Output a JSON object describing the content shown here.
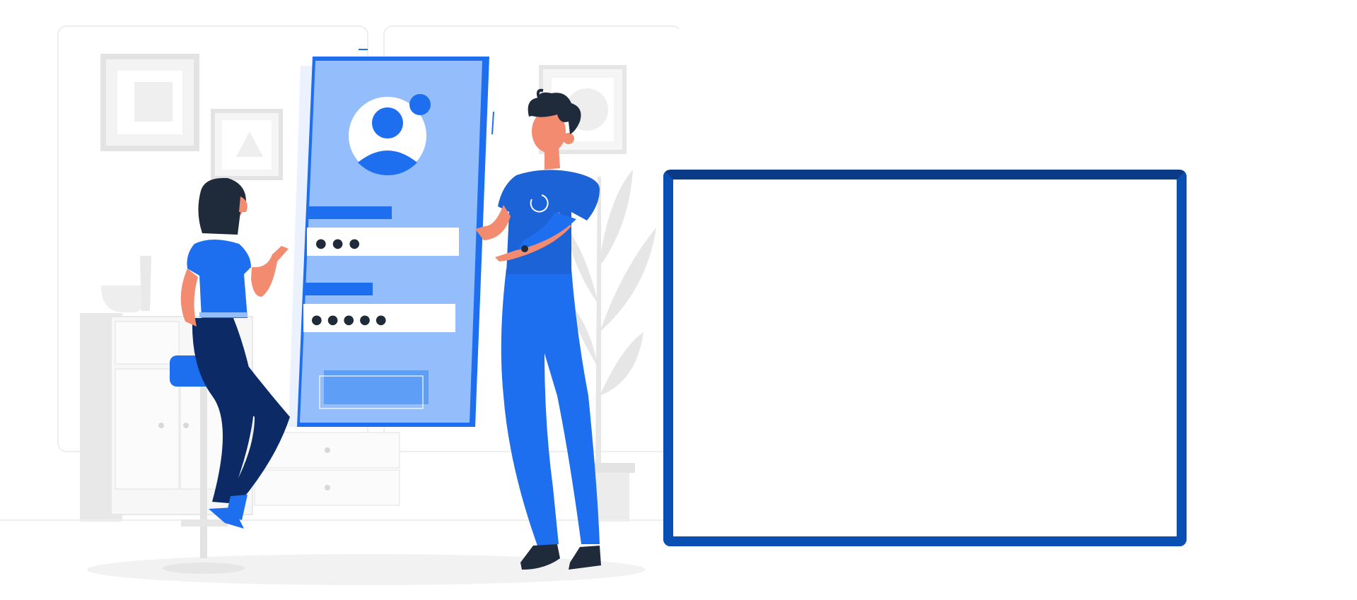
{
  "colors": {
    "primary": "#1e6ff0",
    "primary_light": "#94bdfb",
    "navy": "#0b2a66",
    "frame_border": "#0a4fb3",
    "background": "#ffffff",
    "decor_gray": "#e6e6e6"
  },
  "illustration": {
    "subject": "login-screen-illustration",
    "masked_password_1": "●●●",
    "masked_password_2": "●●●●●"
  },
  "panel": {
    "state": "empty"
  }
}
